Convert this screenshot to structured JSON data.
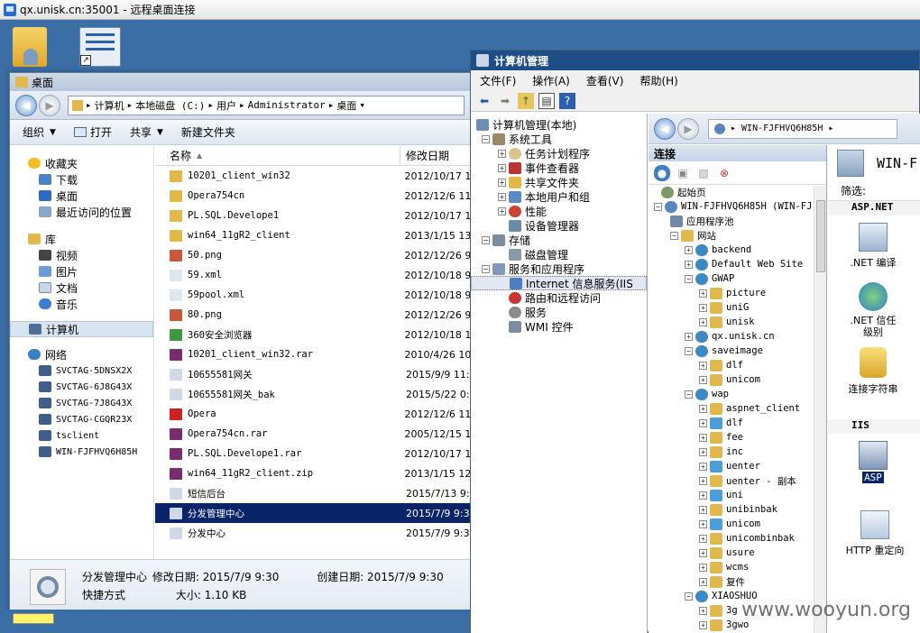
{
  "rdp": {
    "title": "qx.unisk.cn:35001 - 远程桌面连接"
  },
  "explorer": {
    "title": "桌面",
    "breadcrumb": [
      "计算机",
      "本地磁盘 (C:)",
      "用户",
      "Administrator",
      "桌面"
    ],
    "toolbar": {
      "organize": "组织",
      "open": "打开",
      "share": "共享",
      "new_folder": "新建文件夹"
    },
    "nav": {
      "favorites": "收藏夹",
      "downloads": "下载",
      "desktop": "桌面",
      "recent": "最近访问的位置",
      "libraries": "库",
      "videos": "视频",
      "pictures": "图片",
      "documents": "文档",
      "music": "音乐",
      "computer": "计算机",
      "network": "网络",
      "hosts": [
        "SVCTAG-5DNSX2X",
        "SVCTAG-6J8G43X",
        "SVCTAG-7J8G43X",
        "SVCTAG-CGQR23X",
        "tsclient",
        "WIN-FJFHVQ6H85H"
      ]
    },
    "columns": {
      "name": "名称",
      "modified": "修改日期"
    },
    "files": [
      {
        "name": "10201_client_win32",
        "date": "2012/10/17 1"
      },
      {
        "name": "Opera754cn",
        "date": "2012/12/6 11"
      },
      {
        "name": "PL.SQL.Develope1",
        "date": "2012/10/17 1"
      },
      {
        "name": "win64_11gR2_client",
        "date": "2013/1/15 13"
      },
      {
        "name": "50.png",
        "date": "2012/12/26 9"
      },
      {
        "name": "59.xml",
        "date": "2012/10/18 9"
      },
      {
        "name": "59pool.xml",
        "date": "2012/10/18 9"
      },
      {
        "name": "80.png",
        "date": "2012/12/26 9"
      },
      {
        "name": "360安全浏览器",
        "date": "2012/10/18 1"
      },
      {
        "name": "10201_client_win32.rar",
        "date": "2010/4/26 10"
      },
      {
        "name": "10655581网关",
        "date": "2015/9/9 11:"
      },
      {
        "name": "10655581网关_bak",
        "date": "2015/5/22 0:"
      },
      {
        "name": "Opera",
        "date": "2012/12/6 11"
      },
      {
        "name": "Opera754cn.rar",
        "date": "2005/12/15 1"
      },
      {
        "name": "PL.SQL.Develope1.rar",
        "date": "2012/10/17 1"
      },
      {
        "name": "win64_11gR2_client.zip",
        "date": "2013/1/15 12"
      },
      {
        "name": "短信后台",
        "date": "2015/7/13 9:"
      },
      {
        "name": "分发管理中心",
        "date": "2015/7/9 9:3"
      },
      {
        "name": "分发中心",
        "date": "2015/7/9 9:3"
      }
    ],
    "details": {
      "name": "分发管理中心",
      "modified_label": "修改日期: 2015/7/9 9:30",
      "created_label": "创建日期: 2015/7/9 9:30",
      "type": "快捷方式",
      "size_label": "大小: 1.10 KB"
    }
  },
  "cm": {
    "title": "计算机管理",
    "menu": [
      "文件(F)",
      "操作(A)",
      "查看(V)",
      "帮助(H)"
    ],
    "tree": {
      "root": "计算机管理(本地)",
      "tools": "系统工具",
      "task": "任务计划程序",
      "event": "事件查看器",
      "shared": "共享文件夹",
      "users": "本地用户和组",
      "perf": "性能",
      "devmgr": "设备管理器",
      "storage": "存储",
      "disk": "磁盘管理",
      "services_apps": "服务和应用程序",
      "iis": "Internet 信息服务(IIS",
      "routing": "路由和远程访问",
      "services": "服务",
      "wmi": "WMI 控件"
    },
    "iis": {
      "crumb": "WIN-FJFHVQ6H85H",
      "conn_title": "连接",
      "start": "起始页",
      "server": "WIN-FJFHVQ6H85H (WIN-FJ",
      "apppools": "应用程序池",
      "sites": "网站",
      "sites_list": [
        "backend",
        "Default Web Site",
        "GWAP"
      ],
      "gwap_children": [
        "picture",
        "uniG",
        "unisk"
      ],
      "sites2": [
        "qx.unisk.cn",
        "saveimage"
      ],
      "saveimage_children": [
        "dlf",
        "unicom"
      ],
      "wap": "wap",
      "wap_children": [
        "aspnet_client",
        "dlf",
        "fee",
        "inc",
        "uenter",
        "uenter - 副本",
        "uni",
        "unibinbak",
        "unicom",
        "unicombinbak",
        "usure",
        "wcms",
        "复件"
      ],
      "more": [
        "XIAOSHUO",
        "3g",
        "3gwo"
      ],
      "feat_title": "WIN-F",
      "filter": "筛选:",
      "aspnet": "ASP.NET",
      "net_compile": ".NET 编译",
      "net_trust": ".NET 信任级别",
      "connstr": "连接字符串",
      "iis_label": "IIS",
      "asp": "ASP",
      "http_redirect": "HTTP 重定向"
    }
  },
  "watermark": "www.wooyun.org"
}
